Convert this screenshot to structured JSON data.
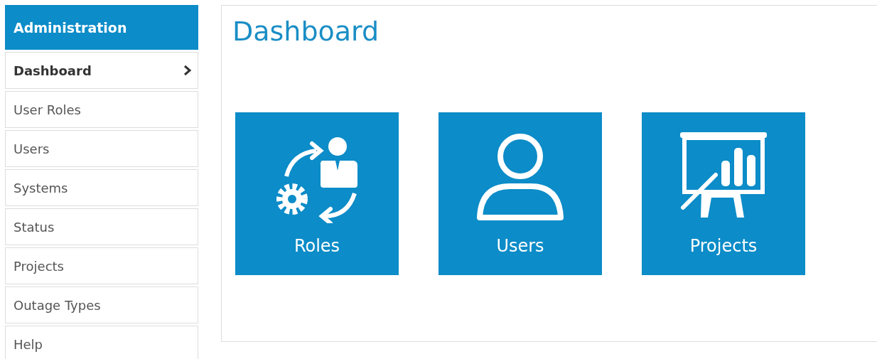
{
  "sidebar": {
    "title": "Administration",
    "items": [
      {
        "label": "Dashboard",
        "selected": true
      },
      {
        "label": "User Roles",
        "selected": false
      },
      {
        "label": "Users",
        "selected": false
      },
      {
        "label": "Systems",
        "selected": false
      },
      {
        "label": "Status",
        "selected": false
      },
      {
        "label": "Projects",
        "selected": false
      },
      {
        "label": "Outage Types",
        "selected": false
      },
      {
        "label": "Help",
        "selected": false
      }
    ]
  },
  "main": {
    "title": "Dashboard",
    "tiles": [
      {
        "kind": "roles",
        "label": "Roles"
      },
      {
        "kind": "users",
        "label": "Users"
      },
      {
        "kind": "projects",
        "label": "Projects"
      }
    ]
  }
}
